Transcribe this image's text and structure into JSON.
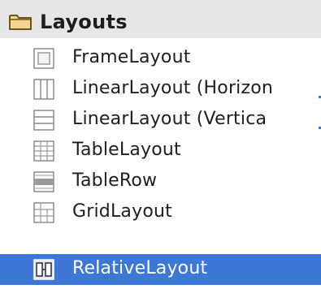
{
  "palette": {
    "header_bg": "#e6e6e6",
    "selection_bg": "#3e78d6",
    "folder_fill": "#f4d58d",
    "folder_stroke": "#6b5518"
  },
  "section": {
    "title": "Layouts",
    "icon": "folder-icon"
  },
  "items": [
    {
      "label": "FrameLayout",
      "icon": "frame-layout-icon",
      "selected": false
    },
    {
      "label": "LinearLayout (Horizon",
      "icon": "linear-layout-horizontal-icon",
      "selected": false
    },
    {
      "label": "LinearLayout (Vertica",
      "icon": "linear-layout-vertical-icon",
      "selected": false
    },
    {
      "label": "TableLayout",
      "icon": "table-layout-icon",
      "selected": false
    },
    {
      "label": "TableRow",
      "icon": "table-row-icon",
      "selected": false
    },
    {
      "label": "GridLayout",
      "icon": "grid-layout-icon",
      "selected": false
    },
    {
      "label": "RelativeLayout",
      "icon": "relative-layout-icon",
      "selected": true
    }
  ]
}
